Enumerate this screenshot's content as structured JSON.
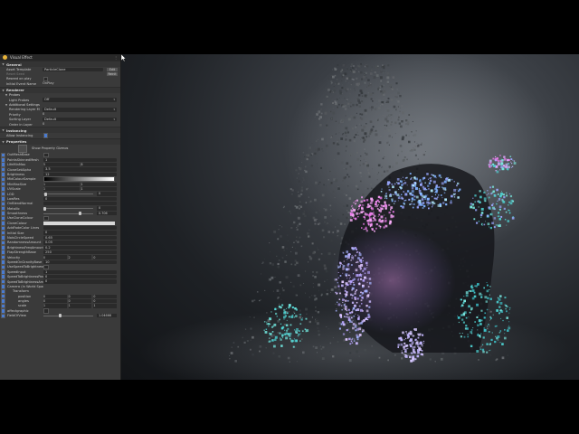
{
  "panel": {
    "title": "Visual Effect",
    "general": {
      "header": "General",
      "asset_template_label": "Asset Template",
      "asset_template_value": "ParticleClone",
      "edit_label": "Edit",
      "reinit_label": "Reinit",
      "reset_seed_label": "Reset Seed",
      "reseed_label": "Reseed on play",
      "initial_event_label": "Initial Event Name",
      "initial_event_value": "OnPlay"
    },
    "renderer": {
      "header": "Renderer",
      "probes_header": "Probes",
      "light_probes_label": "Light Probes",
      "light_probes_value": "Off",
      "additional_header": "Additional Settings",
      "rendering_layer_label": "Rendering Layer M",
      "rendering_layer_value": "Default",
      "priority_label": "Priority",
      "priority_value": "0",
      "sorting_layer_label": "Sorting Layer",
      "sorting_layer_value": "Default",
      "order_label": "Order in Layer",
      "order_value": "0"
    },
    "instancing": {
      "header": "Instancing",
      "allow_label": "Allow Instancing"
    },
    "properties": {
      "header": "Properties",
      "show_slider_label": "Show Property Gizmos",
      "items": [
        {
          "label": "OutMeshBase",
          "kind": "chk"
        },
        {
          "label": "PointsSkinnedMesh",
          "kind": "val",
          "value": "1"
        },
        {
          "label": "LifeMinMax",
          "kind": "vec2",
          "x": "5",
          "y": "8"
        },
        {
          "label": "CloneSetAlpha",
          "kind": "val",
          "value": "3.5"
        },
        {
          "label": "Brightness",
          "kind": "val",
          "value": "12"
        },
        {
          "label": "MidColourSample",
          "kind": "gradient"
        },
        {
          "label": "MinMaxSize",
          "kind": "vec2",
          "x": "1",
          "y": "1"
        },
        {
          "label": "UVScale",
          "kind": "vec2",
          "x": "1",
          "y": "1"
        },
        {
          "label": "LOD",
          "kind": "slider",
          "value": "0",
          "pos": 0.02
        },
        {
          "label": "LowRes",
          "kind": "val",
          "value": "0"
        },
        {
          "label": "OnBlendNormal",
          "kind": "val",
          "value": ""
        },
        {
          "label": "Metallic",
          "kind": "slider",
          "value": "0",
          "pos": 0.0
        },
        {
          "label": "Smoothness",
          "kind": "slider",
          "value": "0.706",
          "pos": 0.7
        },
        {
          "label": "UseCloneColour",
          "kind": "chk"
        },
        {
          "label": "CloneColour",
          "kind": "swatch"
        },
        {
          "label": "AddFadeColor Lines",
          "kind": "val",
          "value": ""
        },
        {
          "label": "Initial Size",
          "kind": "val",
          "value": "0"
        },
        {
          "label": "NoisCircleSpeed",
          "kind": "val",
          "value": "0.65"
        },
        {
          "label": "RandomnessAmount",
          "kind": "val",
          "value": "0.05"
        },
        {
          "label": "BrightnessFreqAmount",
          "kind": "val",
          "value": "0.2"
        },
        {
          "label": "FlapStrengthBase",
          "kind": "val",
          "value": "250"
        },
        {
          "label": "Velocity",
          "kind": "vec3",
          "x": "0",
          "y": "2",
          "z": "0"
        },
        {
          "label": "SpeedOnGravityBase",
          "kind": "val",
          "value": "10"
        },
        {
          "label": "UseSpeedToBrightness",
          "kind": "chk"
        },
        {
          "label": "SpeedInput",
          "kind": "val",
          "value": "1"
        },
        {
          "label": "SpeedToBrightnessPower",
          "kind": "val",
          "value": "0"
        },
        {
          "label": "SpeedToBrightnessAmp",
          "kind": "val",
          "value": "0"
        },
        {
          "label": "Camera (in World Space)",
          "kind": "plain"
        },
        {
          "label": "Transform",
          "kind": "plain",
          "indent": 1
        },
        {
          "label": "position",
          "kind": "vec3",
          "x": "0",
          "y": "0",
          "z": "0",
          "indent": 2
        },
        {
          "label": "angles",
          "kind": "vec3",
          "x": "0",
          "y": "0",
          "z": "0",
          "indent": 2
        },
        {
          "label": "scale",
          "kind": "vec3",
          "x": "1",
          "y": "1",
          "z": "1",
          "indent": 2
        },
        {
          "label": "affectgraphic",
          "kind": "chk"
        },
        {
          "label": "FieldOfView",
          "kind": "slider",
          "value": "1.04666",
          "pos": 0.3
        }
      ]
    }
  },
  "viewport": {
    "background": "#2b2f34",
    "accent_pink": "#f07cf0",
    "accent_cyan": "#4fd6d6",
    "accent_blue": "#6f8bf5"
  }
}
